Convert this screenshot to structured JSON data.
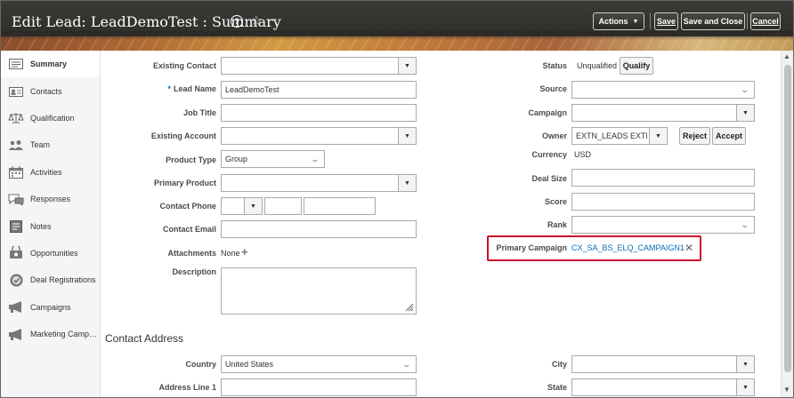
{
  "header": {
    "title": "Edit Lead: LeadDemoTest : Summary",
    "help_icon": "help-circle-icon",
    "favorite_icon": "star-outline-icon",
    "actions_label": "Actions",
    "save_label": "Save",
    "save_close_label": "Save and Close",
    "cancel_label": "Cancel"
  },
  "sidebar": {
    "items": [
      {
        "label": "Summary",
        "icon": "summary-icon"
      },
      {
        "label": "Contacts",
        "icon": "contacts-icon"
      },
      {
        "label": "Qualification",
        "icon": "scale-icon"
      },
      {
        "label": "Team",
        "icon": "team-icon"
      },
      {
        "label": "Activities",
        "icon": "activities-icon"
      },
      {
        "label": "Responses",
        "icon": "responses-icon"
      },
      {
        "label": "Notes",
        "icon": "notes-icon"
      },
      {
        "label": "Opportunities",
        "icon": "opportunities-icon"
      },
      {
        "label": "Deal Registrations",
        "icon": "deal-registrations-icon"
      },
      {
        "label": "Campaigns",
        "icon": "megaphone-icon"
      },
      {
        "label": "Marketing Camp…",
        "icon": "megaphone-icon"
      }
    ]
  },
  "form": {
    "existing_contact_label": "Existing Contact",
    "existing_contact_value": "",
    "lead_name_required": "*",
    "lead_name_label": "Lead Name",
    "lead_name_value": "LeadDemoTest",
    "job_title_label": "Job Title",
    "job_title_value": "",
    "existing_account_label": "Existing Account",
    "existing_account_value": "",
    "product_type_label": "Product Type",
    "product_type_value": "Group",
    "primary_product_label": "Primary Product",
    "primary_product_value": "",
    "contact_phone_label": "Contact Phone",
    "contact_email_label": "Contact Email",
    "attachments_label": "Attachments",
    "attachments_value": "None",
    "description_label": "Description",
    "status_label": "Status",
    "status_value": "Unqualified",
    "qualify_label": "Qualify",
    "source_label": "Source",
    "campaign_label": "Campaign",
    "owner_label": "Owner",
    "owner_value": "EXTN_LEADS EXTN",
    "reject_label": "Reject",
    "accept_label": "Accept",
    "currency_label": "Currency",
    "currency_value": "USD",
    "deal_size_label": "Deal Size",
    "score_label": "Score",
    "rank_label": "Rank",
    "primary_campaign_label": "Primary Campaign",
    "primary_campaign_value": "CX_SA_BS_ELQ_CAMPAIGN1",
    "contact_address_title": "Contact Address",
    "country_label": "Country",
    "country_value": "United States",
    "address_line1_label": "Address Line 1",
    "city_label": "City",
    "state_label": "State"
  },
  "colors": {
    "highlight_border": "#c8102e",
    "link": "#0a6fb8",
    "header_bg": "#2b2926"
  }
}
